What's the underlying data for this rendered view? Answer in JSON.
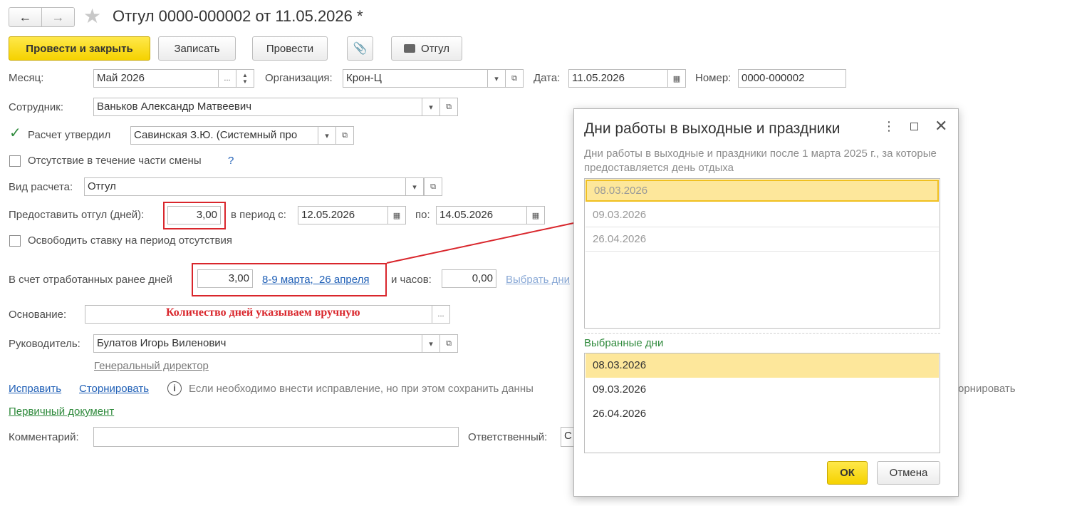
{
  "header": {
    "title": "Отгул 0000-000002 от 11.05.2026 *",
    "back_icon": "←",
    "forward_icon": "→"
  },
  "toolbar": {
    "post_close": "Провести и закрыть",
    "save": "Записать",
    "post": "Провести",
    "print": "Отгул"
  },
  "form": {
    "month_label": "Месяц:",
    "month_value": "Май 2026",
    "org_label": "Организация:",
    "org_value": "Крон-Ц",
    "date_label": "Дата:",
    "date_value": "11.05.2026",
    "number_label": "Номер:",
    "number_value": "0000-000002",
    "employee_label": "Сотрудник:",
    "employee_value": "Ваньков Александр Матвеевич",
    "approved_label": "Расчет утвердил",
    "approved_value": "Савинская З.Ю. (Системный про",
    "partial_shift_label": "Отсутствие в течение части смены",
    "help_mark": "?",
    "calc_type_label": "Вид расчета:",
    "calc_type_value": "Отгул",
    "days_label": "Предоставить отгул (дней):",
    "days_value": "3,00",
    "period_from_label": "в период с:",
    "period_from_value": "12.05.2026",
    "period_to_label": "по:",
    "period_to_value": "14.05.2026",
    "free_rate_label": "Освободить ставку на период отсутствия",
    "worked_label": "В счет отработанных ранее дней",
    "worked_value": "3,00",
    "worked_link": "8-9 марта;  26 апреля",
    "hours_label": "и часов:",
    "hours_value": "0,00",
    "choose_days_link": "Выбрать дни",
    "basis_label": "Основание:",
    "annotation": "Количество дней указываем вручную",
    "manager_label": "Руководитель:",
    "manager_value": "Булатов Игорь Виленович",
    "manager_position": "Генеральный директор",
    "fix_link": "Исправить",
    "reverse_link": "Сторнировать",
    "info_text": "Если необходимо внести исправление, но при этом сохранить данны",
    "info_text_tail": "орнировать",
    "primary_doc_link": "Первичный документ",
    "comment_label": "Комментарий:",
    "responsible_label": "Ответственный:",
    "responsible_value": "С"
  },
  "dialog": {
    "title": "Дни работы в выходные и праздники",
    "subtitle": "Дни работы в выходные и праздники после 1 марта 2025 г., за которые предоставляется день отдыха",
    "available_days": [
      "08.03.2026",
      "09.03.2026",
      "26.04.2026"
    ],
    "selected_label": "Выбранные дни",
    "selected_days": [
      "08.03.2026",
      "09.03.2026",
      "26.04.2026"
    ],
    "ok": "ОК",
    "cancel": "Отмена"
  },
  "colors": {
    "accent_yellow": "#f5d200",
    "highlight_row": "#fde79b",
    "annotation_red": "#d9262c",
    "link_blue": "#1f5fb6",
    "green": "#2f8a3c"
  }
}
